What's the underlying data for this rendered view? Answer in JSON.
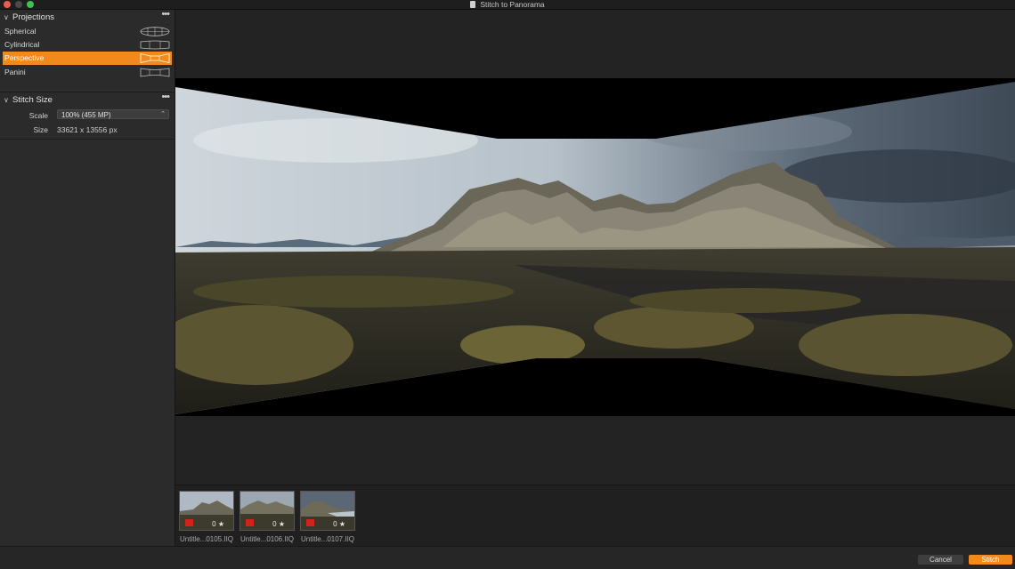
{
  "window": {
    "title": "Stitch to Panorama"
  },
  "projections": {
    "header": "Projections",
    "items": [
      {
        "label": "Spherical",
        "shape": "spherical-icon"
      },
      {
        "label": "Cylindrical",
        "shape": "cylindrical-icon"
      },
      {
        "label": "Perspective",
        "shape": "perspective-icon",
        "selected": true
      },
      {
        "label": "Panini",
        "shape": "panini-icon"
      }
    ]
  },
  "stitch_size": {
    "header": "Stitch Size",
    "scale_label": "Scale",
    "scale_value": "100% (455 MP)",
    "size_label": "Size",
    "size_value": "33621 x 13556 px"
  },
  "filmstrip": {
    "items": [
      {
        "name": "Untitle...0105.IIQ",
        "rating": "0 ★"
      },
      {
        "name": "Untitle...0106.IIQ",
        "rating": "0 ★"
      },
      {
        "name": "Untitle...0107.IIQ",
        "rating": "0 ★"
      }
    ]
  },
  "buttons": {
    "cancel": "Cancel",
    "stitch": "Stitch"
  },
  "colors": {
    "accent": "#f18a1c",
    "badge": "#d0241b"
  }
}
